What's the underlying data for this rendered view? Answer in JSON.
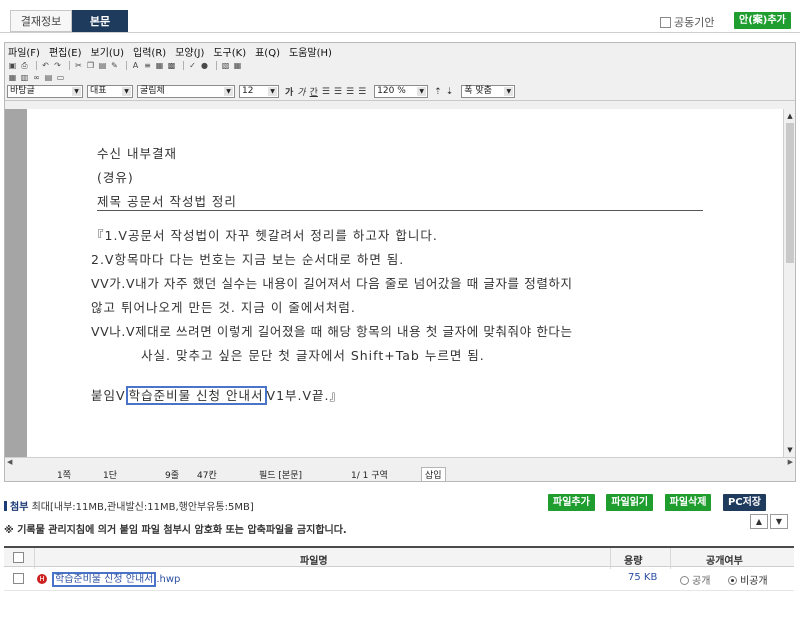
{
  "tabs": [
    {
      "label": "결재정보",
      "active": false
    },
    {
      "label": "본문",
      "active": true
    }
  ],
  "header": {
    "joint_term_label": "공동기안",
    "sign_add_button": "안(案)추가"
  },
  "editor": {
    "menu": [
      "파일(F)",
      "편집(E)",
      "보기(U)",
      "입력(R)",
      "모양(J)",
      "도구(K)",
      "표(Q)",
      "도움말(H)"
    ],
    "format": {
      "style": "바탕글",
      "language": "대표",
      "font": "굴림체",
      "size": "12",
      "line_spacing": "120 %",
      "zoom": "폭 맞춤"
    },
    "format_icons": [
      "bold-icon",
      "italic-icon",
      "underline-icon",
      "align-left-icon",
      "align-center-icon",
      "align-right-icon",
      "align-justify-icon"
    ],
    "doc": {
      "recipient": "수신   내부결재",
      "via": "(경유)",
      "subject": "제목   공문서 작성법 정리",
      "lines": [
        "『1.V공문서 작성법이 자꾸 헷갈려서 정리를 하고자 합니다.",
        "2.V항목마다 다는 번호는 지금 보는 순서대로 하면 됨.",
        "VV가.V내가 자주 했던 실수는 내용이 길어져서 다음 줄로 넘어갔을 때 글자를 정렬하지",
        "않고 튀어나오게 만든 것. 지금 이 줄에서처럼.",
        "VV나.V제대로 쓰려면 이렇게 길어졌을 때 해당 항목의 내용 첫 글자에 맞춰줘야 한다는",
        "사실. 맞추고 싶은 문단 첫 글자에서 Shift+Tab 누르면 됨."
      ],
      "attachment_prefix": "붙임V",
      "attachment_name": "학습준비물 신청 안내서",
      "attachment_suffix": "V1부.V끝.』"
    },
    "status": {
      "page": "1쪽",
      "section": "1단",
      "line": "9줄",
      "column": "47칸",
      "field": "필드 [본문]",
      "page_of": "1/ 1 구역",
      "mode": "삽입"
    }
  },
  "attachments": {
    "title": "첨부",
    "limit_text": "최대[내부:11MB,관내발신:11MB,행안부유통:5MB]",
    "notice": "※ 기록물 관리지침에 의거 붙임 파일 첨부시 암호화 또는 압축파일을 금지합니다.",
    "buttons": [
      "파일추가",
      "파일읽기",
      "파일삭제",
      "PC저장"
    ],
    "columns": {
      "name": "파일명",
      "size": "용량",
      "visibility": "공개여부"
    },
    "files": [
      {
        "name": "학습준비물 신청 안내서",
        "ext": ".hwp",
        "size": "75 KB",
        "public_label": "공개",
        "private_label": "비공개",
        "visibility": "private"
      }
    ]
  },
  "colors": {
    "tab_active": "#1e3a5c",
    "button_green": "#1f9d2f",
    "highlight_box": "#4a74c8",
    "link_blue": "#2b4fa2"
  }
}
